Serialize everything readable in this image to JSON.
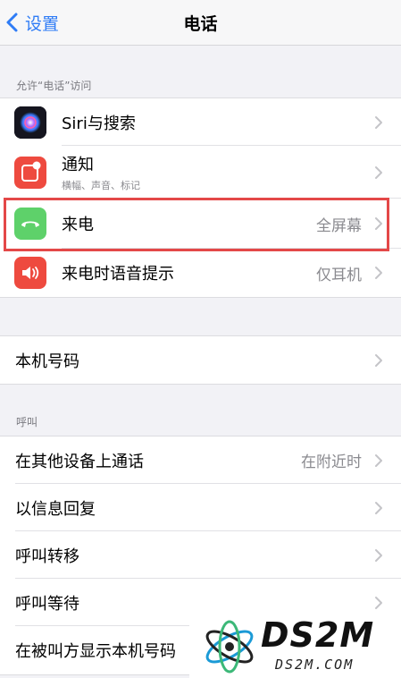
{
  "nav": {
    "back_label": "设置",
    "title": "电话"
  },
  "section_allow": {
    "header": "允许“电话”访问"
  },
  "items_allow": [
    {
      "label": "Siri与搜索",
      "sub": "",
      "value": "",
      "icon": "siri-icon"
    },
    {
      "label": "通知",
      "sub": "横幅、声音、标记",
      "value": "",
      "icon": "notification-icon"
    },
    {
      "label": "来电",
      "sub": "",
      "value": "全屏幕",
      "icon": "phone-icon"
    },
    {
      "label": "来电时语音提示",
      "sub": "",
      "value": "仅耳机",
      "icon": "speaker-icon"
    }
  ],
  "my_number": {
    "label": "本机号码"
  },
  "section_calls": {
    "header": "呼叫"
  },
  "items_calls": [
    {
      "label": "在其他设备上通话",
      "value": "在附近时"
    },
    {
      "label": "以信息回复",
      "value": ""
    },
    {
      "label": "呼叫转移",
      "value": ""
    },
    {
      "label": "呼叫等待",
      "value": ""
    },
    {
      "label": "在被叫方显示本机号码",
      "value": ""
    }
  ],
  "watermark": {
    "logo_text": "DS2M",
    "site_text": "DS2M.COM"
  },
  "colors": {
    "accent": "#2f7cf6",
    "highlight": "#e44848",
    "notification": "#ee4a3f",
    "phone": "#5ed16a",
    "speaker": "#ee4a3f"
  }
}
